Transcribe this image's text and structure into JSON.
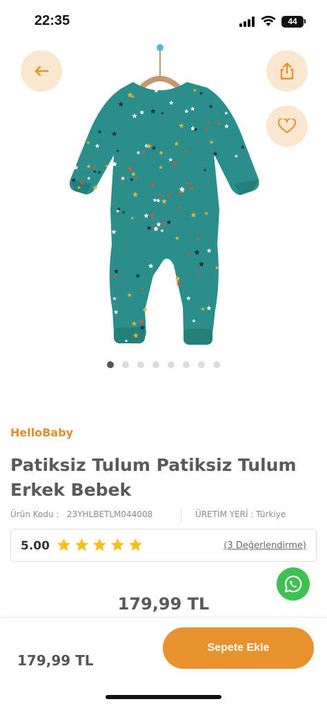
{
  "status_bar": {
    "time": "22:35",
    "battery": "44"
  },
  "product": {
    "brand": "HelloBaby",
    "title": "Patiksiz Tulum Patiksiz Tulum Erkek Bebek",
    "code_label": "Ürün Kodu :",
    "code_value": "23YHLBETLM044008",
    "origin_label": "ÜRETİM YERİ :",
    "origin_value": "Türkiye",
    "rating": "5.00",
    "stars": 5,
    "reviews_label": "(3 Değerlendirme)",
    "price": "179,99 TL",
    "image_count": 8,
    "active_image": 1
  },
  "bottom_bar": {
    "price": "179,99 TL",
    "add_to_cart_label": "Sepete Ekle"
  },
  "colors": {
    "accent": "#e8922e",
    "accent_light": "#fbe6cf",
    "whatsapp": "#3fc051",
    "garment": "#2a8f8a"
  },
  "icons": [
    "back-arrow-icon",
    "share-icon",
    "heart-icon",
    "star-icon",
    "whatsapp-icon",
    "signal-icon",
    "wifi-icon",
    "battery-icon"
  ]
}
